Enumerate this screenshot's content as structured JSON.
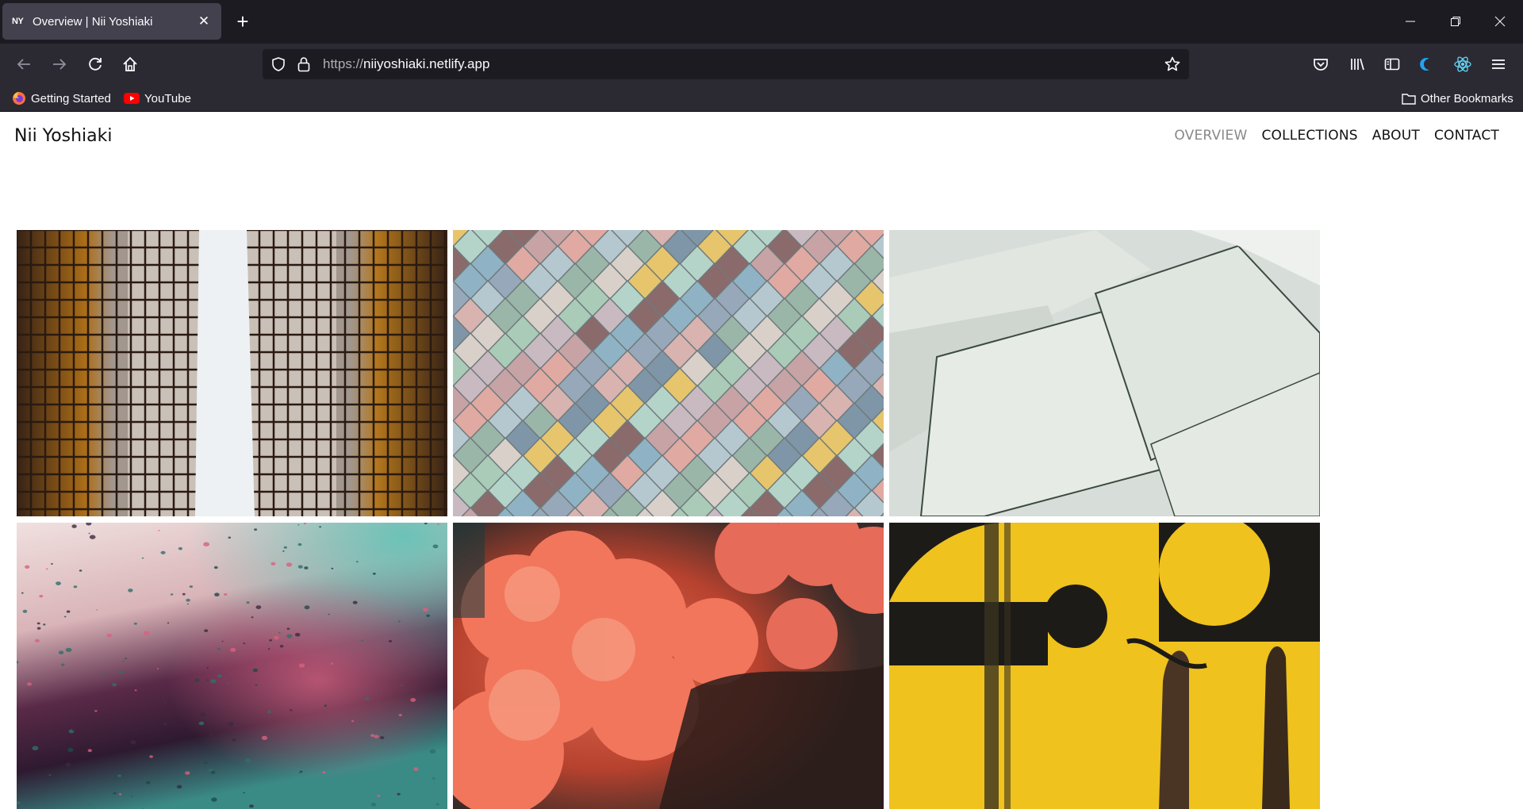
{
  "browser": {
    "tab": {
      "favicon": "NY",
      "title": "Overview | Nii Yoshiaki"
    },
    "url": {
      "scheme": "https://",
      "host": "niiyoshiaki.netlify.app"
    },
    "bookmarks": [
      {
        "label": "Getting Started",
        "icon": "firefox-icon"
      },
      {
        "label": "YouTube",
        "icon": "youtube-icon"
      }
    ],
    "other_bookmarks": "Other Bookmarks"
  },
  "site": {
    "title": "Nii Yoshiaki",
    "nav": [
      {
        "label": "OVERVIEW",
        "active": true
      },
      {
        "label": "COLLECTIONS",
        "active": false
      },
      {
        "label": "ABOUT",
        "active": false
      },
      {
        "label": "CONTACT",
        "active": false
      }
    ]
  },
  "gallery": [
    {
      "name": "glass-skyscrapers-photo"
    },
    {
      "name": "pastel-scale-tiles-photo"
    },
    {
      "name": "white-paper-sheets-photo"
    },
    {
      "name": "rain-droplets-window-photo"
    },
    {
      "name": "red-clouds-photo"
    },
    {
      "name": "yellow-abstract-paint-photo"
    }
  ],
  "colors": {
    "tabstrip": "#1c1b22",
    "toolbar": "#2b2a33",
    "active_tab": "#42414d",
    "nav_active": "#888888",
    "nav_text": "#111111"
  }
}
